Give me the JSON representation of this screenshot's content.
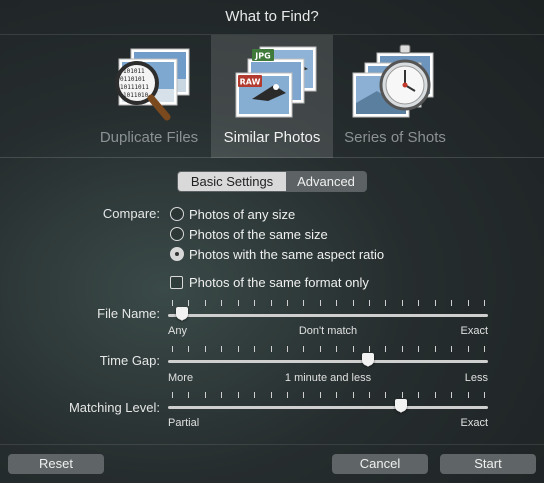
{
  "window": {
    "title": "What to Find?"
  },
  "modes": [
    {
      "label": "Duplicate Files",
      "icon": "magnifier-binary-icon",
      "active": false
    },
    {
      "label": "Similar Photos",
      "icon": "photo-stack-icon",
      "active": true
    },
    {
      "label": "Series of Shots",
      "icon": "stopwatch-photo-icon",
      "active": false
    }
  ],
  "badges": {
    "jpg": "JPG",
    "raw": "RAW"
  },
  "binary_text": [
    "101011",
    "0110101",
    "10111011",
    "1011010"
  ],
  "tabs": {
    "basic": "Basic Settings",
    "advanced": "Advanced",
    "selected": "Advanced"
  },
  "compare": {
    "label": "Compare:",
    "options": [
      "Photos of any size",
      "Photos of the same size",
      "Photos with the same aspect ratio"
    ],
    "selected_index": 2,
    "format_check_label": "Photos of the same format only",
    "format_checked": false
  },
  "sliders": {
    "file_name": {
      "label": "File Name:",
      "left": "Any",
      "middle": "Don't match",
      "right": "Exact",
      "value": 0.02
    },
    "time_gap": {
      "label": "Time Gap:",
      "left": "More",
      "middle": "1 minute and less",
      "right": "Less",
      "value": 0.63
    },
    "matching": {
      "label": "Matching Level:",
      "left": "Partial",
      "right": "Exact",
      "value": 0.74
    }
  },
  "buttons": {
    "reset": "Reset",
    "cancel": "Cancel",
    "start": "Start"
  },
  "colors": {
    "accent_active": "#d9d9d9",
    "raw_badge": "#b23a2e",
    "jpg_badge": "#3f7a3a"
  }
}
